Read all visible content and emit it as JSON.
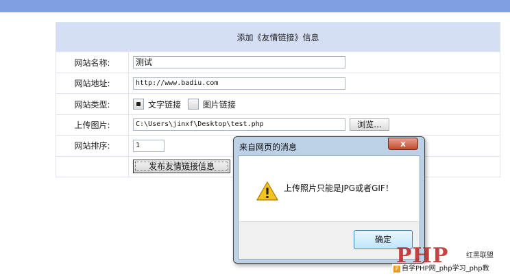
{
  "form": {
    "title": "添加《友情链接》信息",
    "labels": {
      "name": "网站名称:",
      "url": "网站地址:",
      "type": "网站类型:",
      "upload": "上传图片:",
      "order": "网站排序:"
    },
    "values": {
      "name": "测试",
      "url": "http://www.badiu.com",
      "upload": "C:\\Users\\jinxf\\Desktop\\test.php",
      "order": "1"
    },
    "type_options": [
      {
        "label": "文字链接",
        "selected": true
      },
      {
        "label": "图片链接",
        "selected": false
      }
    ],
    "browse_label": "浏览...",
    "submit_label": "发布友情链接信息"
  },
  "dialog": {
    "title": "来自网页的消息",
    "close_label": "x",
    "message": "上传照片只能是JPG或者GIF！",
    "ok_label": "确定"
  },
  "watermark": {
    "logo": "PHP",
    "side_text": "红黑联盟",
    "badge": "P",
    "bar_text": "自学PHP网_php学习_php教"
  },
  "colors": {
    "topbar": "#7f9fe0",
    "header": "#d4def4",
    "dialog_frame": "#bcd0e6",
    "close_button": "#c4482f"
  }
}
